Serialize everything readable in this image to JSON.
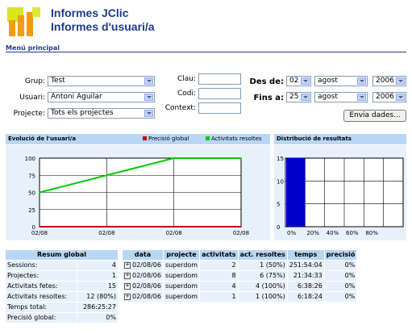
{
  "header": {
    "title_line1": "Informes JClic",
    "title_line2": "Informes d'usuari/a",
    "menu_link": "Menú principal"
  },
  "form": {
    "group_label": "Grup:",
    "group_value": "Test",
    "user_label": "Usuari:",
    "user_value": "Antoni Aguilar",
    "project_label": "Projecte:",
    "project_value": "Tots els projectes",
    "key_label": "Clau:",
    "key_value": "",
    "code_label": "Codi:",
    "code_value": "",
    "context_label": "Context:",
    "context_value": "",
    "from_label": "Des de:",
    "from_day": "02",
    "from_month": "agost",
    "from_year": "2006",
    "to_label": "Fins a:",
    "to_day": "25",
    "to_month": "agost",
    "to_year": "2006",
    "submit_label": "Envia dades..."
  },
  "evolution_panel": {
    "title": "Evolució de l'usuari/a",
    "legend_precision": "Precisió global",
    "legend_activities": "Activitats resoltes"
  },
  "distribution_panel": {
    "title": "Distribució de resultats"
  },
  "chart_data": [
    {
      "type": "line",
      "title": "Evolució de l'usuari/a",
      "x": [
        "02/08",
        "02/08",
        "02/08",
        "02/08"
      ],
      "ylim": [
        0,
        100
      ],
      "yticks": [
        "100",
        "75",
        "50",
        "25",
        "0"
      ],
      "grid": true,
      "legend_position": "top-right",
      "series": [
        {
          "name": "Precisió global",
          "color": "#cc0000",
          "values": [
            0,
            0,
            0,
            0
          ]
        },
        {
          "name": "Activitats resoltes",
          "color": "#00cc00",
          "values": [
            50,
            75,
            100,
            100
          ]
        }
      ]
    },
    {
      "type": "bar",
      "title": "Distribució de resultats",
      "categories": [
        "0%",
        "20%",
        "40%",
        "60%",
        "80%"
      ],
      "values": [
        15,
        0,
        0,
        0,
        0
      ],
      "ylim": [
        0,
        15
      ],
      "yticks": [
        "15",
        "10",
        "5",
        "0"
      ],
      "bar_color": "#0000cc",
      "grid": true
    }
  ],
  "summary": {
    "header": "Resum global",
    "rows": [
      {
        "label": "Sessions:",
        "value": "4"
      },
      {
        "label": "Projectes:",
        "value": "1"
      },
      {
        "label": "Activitats fetes:",
        "value": "15"
      },
      {
        "label": "Activitats resoltes:",
        "value": "12 (80%)"
      },
      {
        "label": "Temps total:",
        "value": "286:25:27"
      },
      {
        "label": "Precisió global:",
        "value": "0%"
      }
    ]
  },
  "sessions": {
    "columns": [
      "data",
      "projecte",
      "activitats",
      "act. resoltes",
      "temps",
      "precisió"
    ],
    "rows": [
      {
        "data": "02/08/06",
        "projecte": "superdom",
        "activitats": "2",
        "resoltes": "1 (50%)",
        "temps": "251:54:04",
        "precisio": "0%"
      },
      {
        "data": "02/08/06",
        "projecte": "superdom",
        "activitats": "8",
        "resoltes": "6 (75%)",
        "temps": "21:34:33",
        "precisio": "0%"
      },
      {
        "data": "02/08/06",
        "projecte": "superdom",
        "activitats": "4",
        "resoltes": "4 (100%)",
        "temps": "6:38:26",
        "precisio": "0%"
      },
      {
        "data": "02/08/06",
        "projecte": "superdom",
        "activitats": "1",
        "resoltes": "1 (100%)",
        "temps": "6:18:24",
        "precisio": "0%"
      }
    ]
  }
}
